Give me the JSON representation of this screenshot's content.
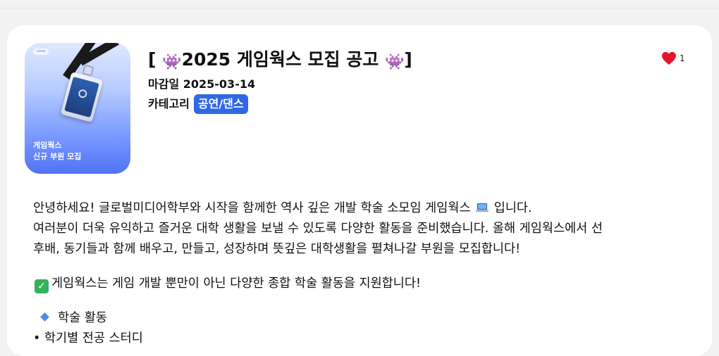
{
  "post": {
    "title": "2025 게임웍스 모집 공고",
    "title_prefix": "[",
    "title_suffix": "]",
    "title_emoji": "👾",
    "deadline_label": "마감일",
    "deadline_value": "2025-03-14",
    "category_label": "카테고리",
    "category_value": "공연/댄스",
    "like_count": "1",
    "thumbnail": {
      "caption_line1": "게임웍스",
      "caption_line2": "신규 부원 모집",
      "tag": "none"
    }
  },
  "body": {
    "line1_before": "안녕하세요! 글로벌미디어학부와 시작을 함께한 역사 깊은 개발 학술 소모임 게임웍스",
    "line1_after": "입니다.",
    "line2": "여러분이 더욱 유익하고 즐거운 대학 생활을 보낼 수 있도록 다양한 활동을 준비했습니다. 올해 게임웍스에서 선",
    "line3": "후배, 동기들과 함께 배우고, 만들고, 성장하며 뜻깊은 대학생활을 펼쳐나갈 부원을 모집합니다!",
    "line4": "게임웍스는 게임 개발 뿐만이 아닌 다양한 종합 학술 활동을 지원합니다!",
    "line5": "학술 활동",
    "line6": "• 학기별 전공 스터디"
  },
  "colors": {
    "category_badge": "#2f67e6",
    "heart": "#e8142b",
    "check": "#36b05a",
    "diamond": "#4b8be6"
  }
}
